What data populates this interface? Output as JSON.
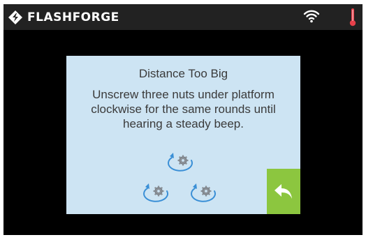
{
  "status_bar": {
    "brand_name": "FLASHFORGE",
    "icons": [
      "flashforge-logo-icon",
      "wifi-icon",
      "thermometer-icon"
    ],
    "colors": {
      "background": "#222222",
      "thermometer": "#e8404a"
    }
  },
  "dialog": {
    "title": "Distance Too Big",
    "message": "Unscrew three nuts under platform clockwise for the same rounds until hearing a steady beep.",
    "diagram_icons": [
      "nut-clockwise-icon",
      "nut-clockwise-icon",
      "nut-clockwise-icon"
    ],
    "back_icon": "back-arrow-icon",
    "colors": {
      "background": "#cde4f3",
      "back_button": "#8cc63f",
      "arrows": "#3a8fd6"
    }
  }
}
